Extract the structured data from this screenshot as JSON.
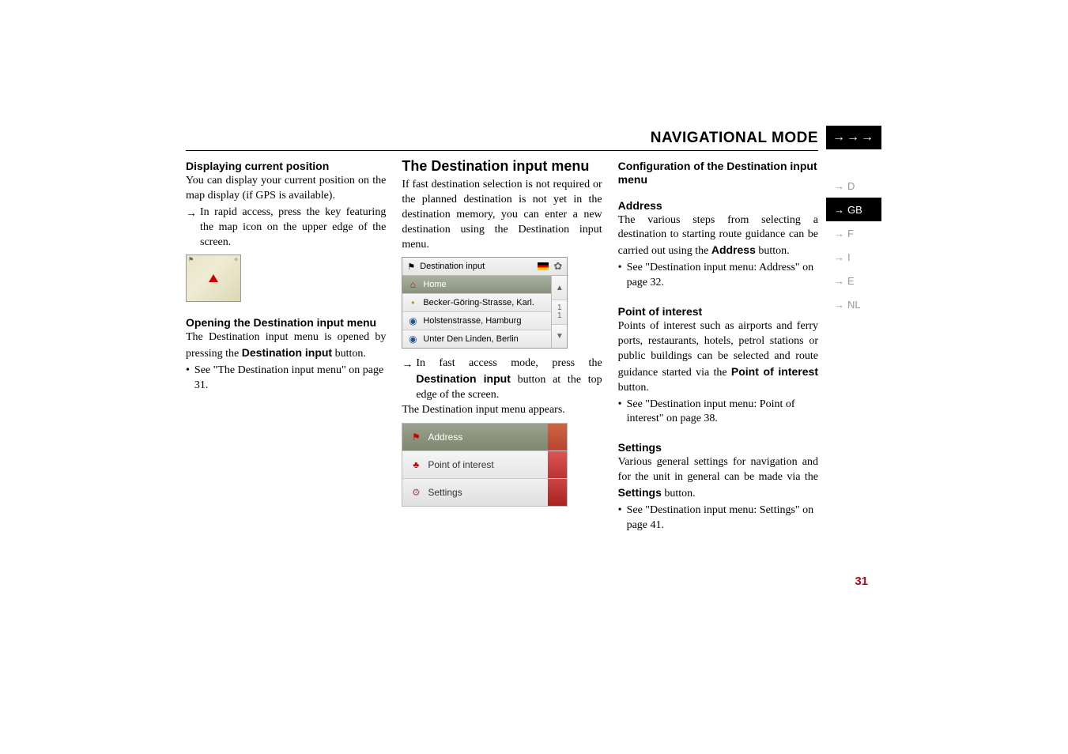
{
  "header": {
    "title": "NAVIGATIONAL MODE",
    "arrows": "→→→"
  },
  "langs": [
    {
      "label": "D",
      "active": false
    },
    {
      "label": "GB",
      "active": true
    },
    {
      "label": "F",
      "active": false
    },
    {
      "label": "I",
      "active": false
    },
    {
      "label": "E",
      "active": false
    },
    {
      "label": "NL",
      "active": false
    }
  ],
  "col1": {
    "h1": "Displaying current position",
    "p1": "You can display your current position on the map display (if GPS is available).",
    "arrow1": "In rapid access, press the key featuring the map icon on the upper edge of the screen.",
    "h2": "Opening the Destination input menu",
    "p2a": "The Destination input menu is opened by pressing the ",
    "p2b": "Destination input",
    "p2c": " button.",
    "bullet1": "See \"The Destination input menu\" on page 31."
  },
  "col2": {
    "hsection": "The Destination input menu",
    "p1": "If fast destination selection is not required or the planned destination is not yet in the destination memory, you can enter a new destination using the Destination input menu.",
    "shot_header": "Destination input",
    "shot_rows": [
      "Home",
      "Becker-Göring-Strasse, Karl.",
      "Holstenstrasse, Hamburg",
      "Unter Den Linden, Berlin"
    ],
    "shot_counter": "1\n1",
    "arrow1a": "In fast access mode, press the ",
    "arrow1b": "Destination input",
    "arrow1c": " button at the top edge of the screen.",
    "p2": "The Destination input menu appears.",
    "menu": [
      "Address",
      "Point of interest",
      "Settings"
    ]
  },
  "col3": {
    "hconfig": "Configuration of the Destination input menu",
    "h_addr": "Address",
    "p_addr_a": "The various steps from selecting a destination to starting route guidance can be carried out using the ",
    "p_addr_b": "Address",
    "p_addr_c": " button.",
    "bullet_addr": "See \"Destination input menu: Address\" on page 32.",
    "h_poi": "Point of interest",
    "p_poi_a": "Points of interest such as airports and ferry ports, restaurants, hotels, petrol stations or public buildings can be selected and route guidance started via the ",
    "p_poi_b": "Point of interest",
    "p_poi_c": " button.",
    "bullet_poi": "See \"Destination input menu: Point of interest\" on page 38.",
    "h_set": "Settings",
    "p_set_a": "Various general settings for navigation and for the unit in general can be made via the ",
    "p_set_b": "Settings",
    "p_set_c": " button.",
    "bullet_set": "See \"Destination input menu: Settings\" on page 41."
  },
  "pagenum": "31",
  "glyphs": {
    "arrow_right": "→",
    "bullet": "•",
    "up_tri": "▲",
    "down_tri": "▼"
  }
}
